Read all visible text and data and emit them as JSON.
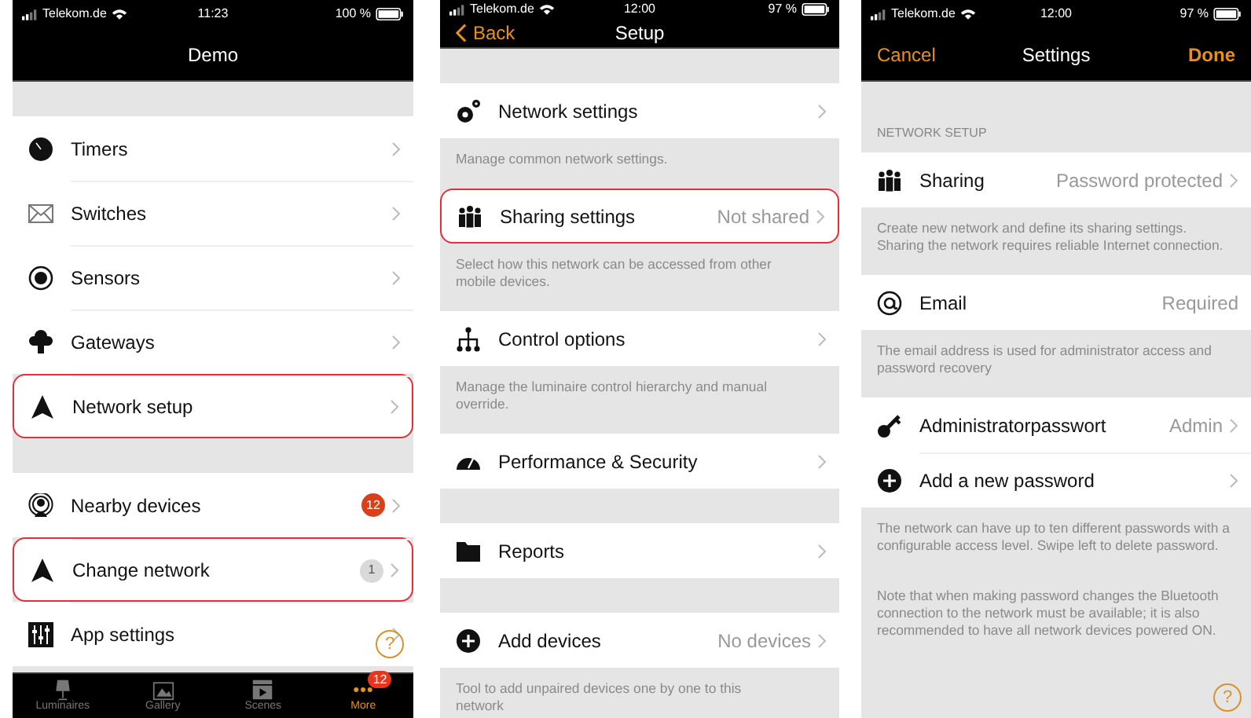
{
  "screens": [
    {
      "status": {
        "carrier": "Telekom.de",
        "time": "11:23",
        "battery": "100 %"
      },
      "nav": {
        "title": "Demo"
      },
      "help": "?",
      "blocks": [
        {
          "kind": "gap"
        },
        {
          "kind": "row",
          "label": "Timers",
          "highlighted": false
        },
        {
          "kind": "row",
          "label": "Switches",
          "highlighted": false
        },
        {
          "kind": "row",
          "label": "Sensors",
          "highlighted": false
        },
        {
          "kind": "row",
          "label": "Gateways",
          "highlighted": false
        },
        {
          "kind": "row",
          "label": "Network setup",
          "highlighted": true
        },
        {
          "kind": "gap"
        },
        {
          "kind": "row",
          "label": "Nearby devices",
          "badge": {
            "text": "12",
            "color": "#d8401a"
          },
          "highlighted": false
        },
        {
          "kind": "row",
          "label": "Change network",
          "badge": {
            "text": "1",
            "color": "#d9d9d9"
          },
          "highlighted": true
        },
        {
          "kind": "row",
          "label": "App settings",
          "highlighted": false
        }
      ],
      "tabbar": [
        {
          "label": "Luminaires",
          "selected": false
        },
        {
          "label": "Gallery",
          "selected": false
        },
        {
          "label": "Scenes",
          "selected": false
        },
        {
          "label": "More",
          "selected": true,
          "badge": "12"
        }
      ]
    },
    {
      "status": {
        "carrier": "Telekom.de",
        "time": "12:00",
        "battery": "97 %"
      },
      "nav": {
        "back": "Back",
        "title": "Setup"
      },
      "blocks": [
        {
          "kind": "gap"
        },
        {
          "kind": "row",
          "label": "Network settings",
          "highlighted": false
        },
        {
          "kind": "note",
          "text": "Manage common network settings."
        },
        {
          "kind": "row",
          "label": "Sharing settings",
          "value": "Not shared",
          "highlighted": true
        },
        {
          "kind": "note",
          "text": "Select how this network can be accessed from other mobile devices."
        },
        {
          "kind": "row",
          "label": "Control options",
          "highlighted": false
        },
        {
          "kind": "note",
          "text": "Manage the luminaire control hierarchy and manual override."
        },
        {
          "kind": "row",
          "label": "Performance & Security",
          "highlighted": false
        },
        {
          "kind": "gap"
        },
        {
          "kind": "row",
          "label": "Reports",
          "highlighted": false
        },
        {
          "kind": "gap"
        },
        {
          "kind": "row",
          "label": "Add devices",
          "value": "No devices",
          "highlighted": false
        },
        {
          "kind": "note",
          "text": "Tool to add unpaired devices one by one to this network"
        }
      ]
    },
    {
      "status": {
        "carrier": "Telekom.de",
        "time": "12:00",
        "battery": "97 %"
      },
      "nav": {
        "cancel": "Cancel",
        "title": "Settings",
        "done": "Done"
      },
      "help": "?",
      "blocks": [
        {
          "kind": "gap"
        },
        {
          "kind": "header",
          "text": "NETWORK SETUP"
        },
        {
          "kind": "row",
          "label": "Sharing",
          "value": "Password protected",
          "highlighted": false
        },
        {
          "kind": "note",
          "text": "Create new network and define its sharing settings. Sharing the network requires reliable Internet connection."
        },
        {
          "kind": "row",
          "label": "Email",
          "value": "Required",
          "chevron": false,
          "highlighted": false
        },
        {
          "kind": "note",
          "text": "The email address is used for administrator access and password recovery"
        },
        {
          "kind": "row",
          "label": "Administratorpasswort",
          "value": "Admin",
          "highlighted": false
        },
        {
          "kind": "row",
          "label": "Add a new password",
          "highlighted": false
        },
        {
          "kind": "note",
          "text": "The network can have up to ten different passwords with a configurable access level. Swipe left to delete password."
        },
        {
          "kind": "note",
          "text": "Note that when making password changes the Bluetooth connection to the network must be available; it is also recommended to have all network devices powered ON."
        }
      ]
    }
  ]
}
